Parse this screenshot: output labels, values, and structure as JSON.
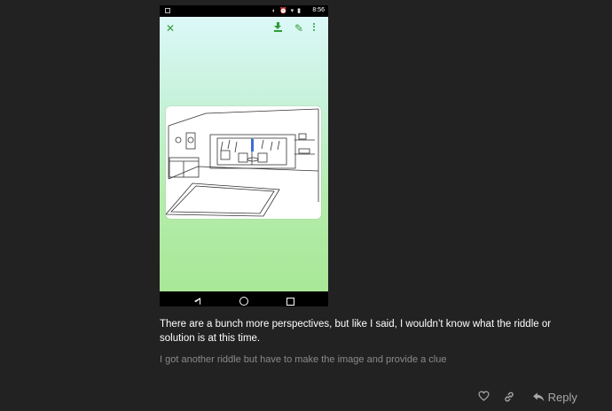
{
  "phone": {
    "status_time": "8:56",
    "status_icons": "◐ ⏰ ▾ ▮",
    "toolbar": {
      "close_icon": "close-icon",
      "download_icon": "download-icon",
      "edit_icon": "edit-icon",
      "more_icon": "more-vert-icon"
    },
    "nav": {
      "back_icon": "back-triangle-icon",
      "home_icon": "home-circle-icon",
      "recent_icon": "recent-square-icon"
    }
  },
  "post": {
    "body": "There are a bunch more perspectives, but like I said, I wouldn’t know what the riddle or solution is at this time.",
    "faded_note": "I got another riddle but have to make the image and provide a clue"
  },
  "actions": {
    "like_icon": "heart-icon",
    "link_icon": "link-icon",
    "reply_label": "Reply"
  }
}
